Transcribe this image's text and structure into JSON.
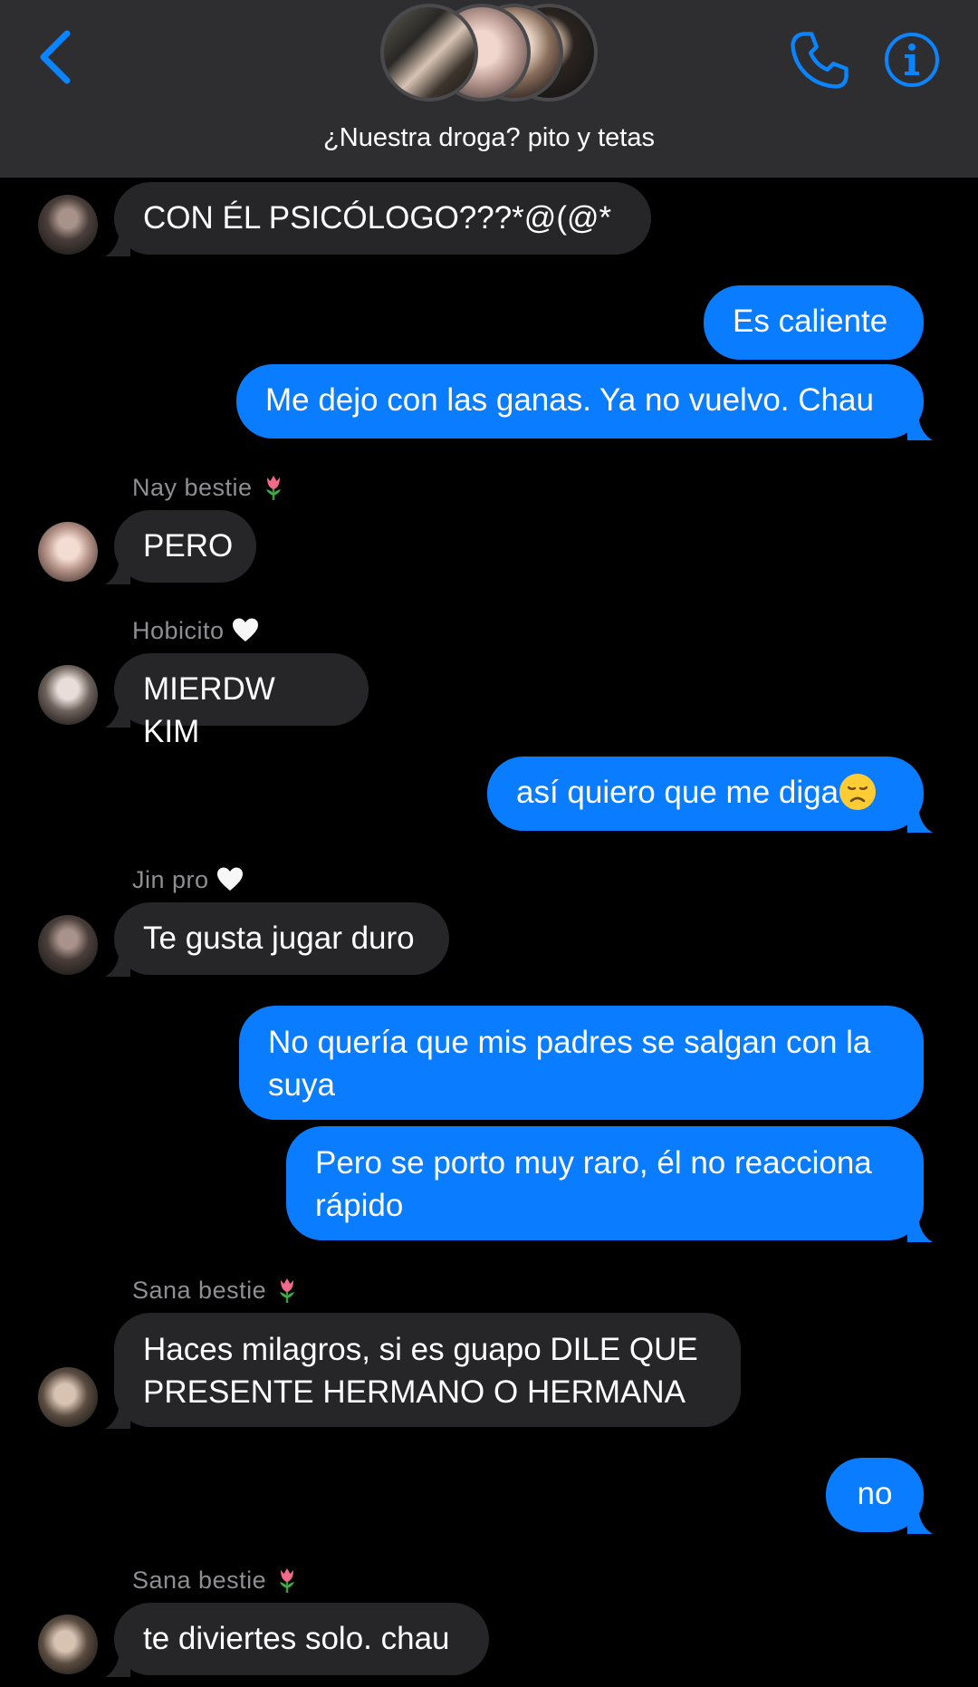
{
  "header": {
    "title": "¿Nuestra droga? pito y tetas",
    "back_icon": "chevron-left-icon",
    "call_icon": "phone-icon",
    "info_icon": "info-icon"
  },
  "messages": [
    {
      "direction": "in",
      "text": "CON ÉL PSICÓLOGO???*@(@*"
    },
    {
      "direction": "out",
      "text": "Es caliente"
    },
    {
      "direction": "out",
      "text": "Me dejo con las ganas. Ya no vuelvo. Chau"
    },
    {
      "direction": "in",
      "sender": "Nay bestie",
      "sender_emoji": "tulip",
      "text": "PERO"
    },
    {
      "direction": "in",
      "sender": "Hobicito",
      "sender_emoji": "white-heart",
      "text": "MIERDW KIM"
    },
    {
      "direction": "out",
      "text": "así quiero que me diga",
      "emoji": "disappointed-face"
    },
    {
      "direction": "in",
      "sender": "Jin pro",
      "sender_emoji": "white-heart",
      "text": "Te gusta jugar duro"
    },
    {
      "direction": "out",
      "lines": [
        "No quería que mis padres se salgan con la",
        "suya"
      ]
    },
    {
      "direction": "out",
      "lines": [
        "Pero se porto muy raro, él no reacciona",
        "rápido"
      ]
    },
    {
      "direction": "in",
      "sender": "Sana bestie",
      "sender_emoji": "tulip",
      "lines": [
        "Haces milagros, si es guapo DILE QUE",
        "PRESENTE HERMANO O HERMANA"
      ]
    },
    {
      "direction": "out",
      "text": "no"
    },
    {
      "direction": "in",
      "sender": "Sana bestie",
      "sender_emoji": "tulip",
      "text": "te diviertes solo. chau"
    }
  ],
  "colors": {
    "background": "#000000",
    "header": "#2e2e30",
    "accent": "#0a84ff",
    "incoming_bubble": "#262629",
    "outgoing_bubble": "#0a7cff",
    "sender_name": "#8e8e93"
  }
}
